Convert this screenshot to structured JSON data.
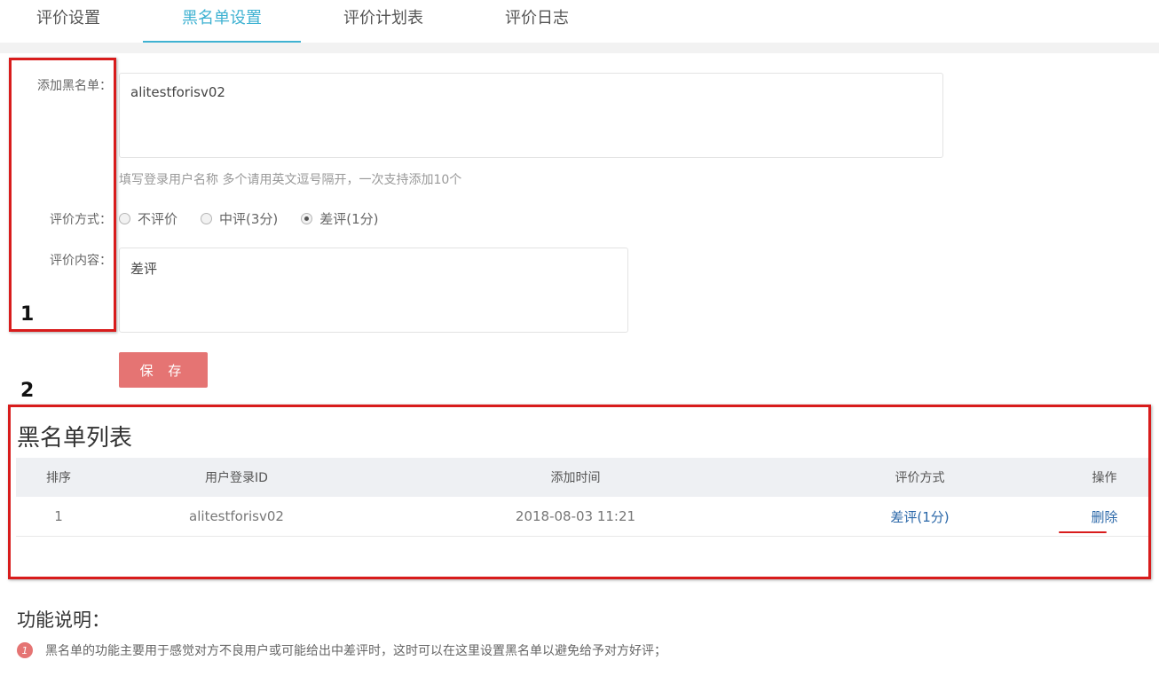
{
  "tabs": [
    {
      "label": "评价设置"
    },
    {
      "label": "黑名单设置",
      "active": true
    },
    {
      "label": "评价计划表"
    },
    {
      "label": "评价日志"
    }
  ],
  "form": {
    "add_label": "添加黑名单：",
    "add_value": "alitestforisv02",
    "hint": "填写登录用户名称 多个请用英文逗号隔开，一次支持添加10个",
    "rating_label": "评价方式：",
    "rating_options": [
      {
        "label": "不评价",
        "checked": false
      },
      {
        "label": "中评(3分)",
        "checked": false
      },
      {
        "label": "差评(1分)",
        "checked": true
      }
    ],
    "content_label": "评价内容：",
    "content_value": "差评",
    "save_label": "保 存"
  },
  "annotations": {
    "box1_number": "1",
    "box2_number": "2",
    "color": "#d81c1c"
  },
  "blacklist": {
    "title": "黑名单列表",
    "headers": [
      "排序",
      "用户登录ID",
      "添加时间",
      "评价方式",
      "操作"
    ],
    "rows": [
      {
        "index": "1",
        "user_id": "alitestforisv02",
        "added_time": "2018-08-03 11:21",
        "rating": "差评(1分)",
        "action": "删除"
      }
    ]
  },
  "description": {
    "title": "功能说明：",
    "items": [
      {
        "num": "1",
        "text": "黑名单的功能主要用于感觉对方不良用户或可能给出中差评时，这时可以在这里设置黑名单以避免给予对方好评；"
      }
    ]
  },
  "colors": {
    "accent": "#3fb2d2",
    "save_button": "#e57473",
    "link": "#2a67a8",
    "annotation_red": "#d81c1c"
  }
}
